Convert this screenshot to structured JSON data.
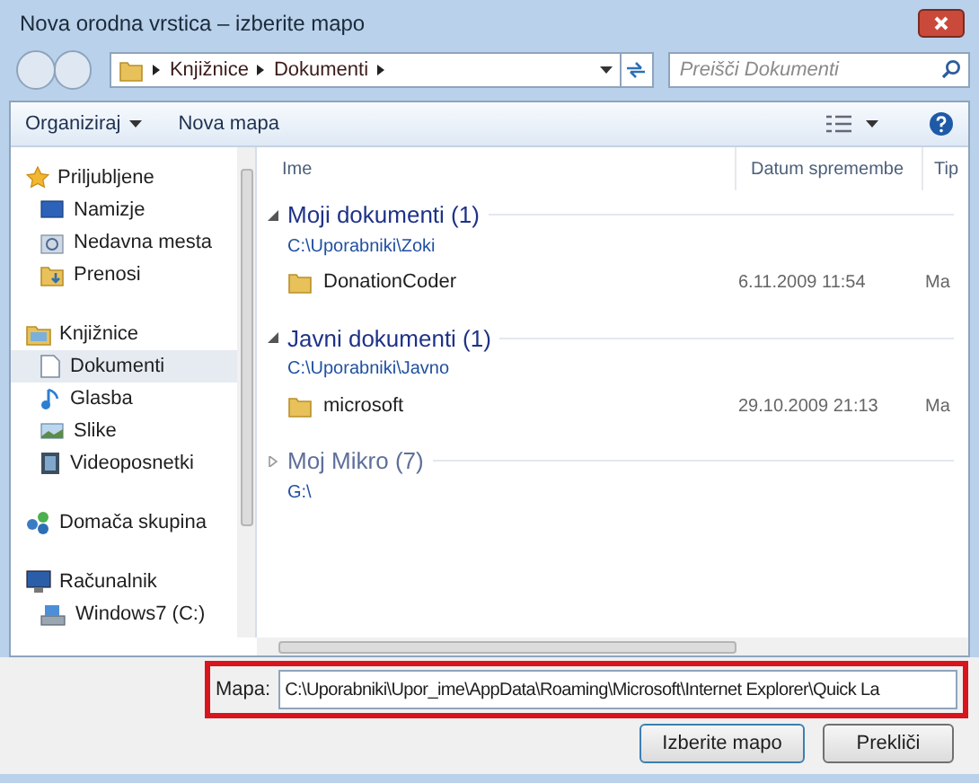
{
  "window": {
    "title": "Nova orodna vrstica – izberite mapo"
  },
  "address": {
    "crumbs": [
      "Knjižnice",
      "Dokumenti"
    ]
  },
  "search": {
    "placeholder": "Preišči Dokumenti"
  },
  "toolbar": {
    "buttons": [
      {
        "label": "Organiziraj",
        "menu": true
      },
      {
        "label": "Nova mapa",
        "menu": false
      }
    ]
  },
  "sidebar": {
    "groups": [
      {
        "label": "Priljubljene",
        "children": [
          {
            "label": "Namizje",
            "selected": false
          },
          {
            "label": "Nedavna mesta",
            "selected": false
          },
          {
            "label": "Prenosi",
            "selected": false
          }
        ]
      },
      {
        "label": "Knjižnice",
        "children": [
          {
            "label": "Dokumenti",
            "selected": true
          },
          {
            "label": "Glasba",
            "selected": false
          },
          {
            "label": "Slike",
            "selected": false
          },
          {
            "label": "Videoposnetki",
            "selected": false
          }
        ]
      },
      {
        "label": "Domača skupina"
      },
      {
        "label": "Računalnik",
        "children": [
          {
            "label": "Windows7 (C:)",
            "selected": false
          }
        ]
      }
    ]
  },
  "table": {
    "columns": [
      "Ime",
      "Datum spremembe",
      "Tip"
    ],
    "groups": [
      {
        "title": "Moji dokumenti (1)",
        "path": "C:\\Uporabniki\\Zoki",
        "expanded": true,
        "rows": [
          {
            "name": "DonationCoder",
            "date": "6.11.2009 11:54",
            "type": "Ma"
          }
        ]
      },
      {
        "title": "Javni dokumenti (1)",
        "path": "C:\\Uporabniki\\Javno",
        "expanded": true,
        "rows": [
          {
            "name": "microsoft",
            "date": "29.10.2009 21:13",
            "type": "Ma"
          }
        ]
      },
      {
        "title": "Moj Mikro (7)",
        "path": "G:\\",
        "expanded": false
      }
    ]
  },
  "folder_field": {
    "label": "Mapa:",
    "value": "C:\\Uporabniki\\Upor_ime\\AppData\\Roaming\\Microsoft\\Internet Explorer\\Quick La"
  },
  "buttons": [
    "Izberite mapo",
    "Prekliči"
  ]
}
